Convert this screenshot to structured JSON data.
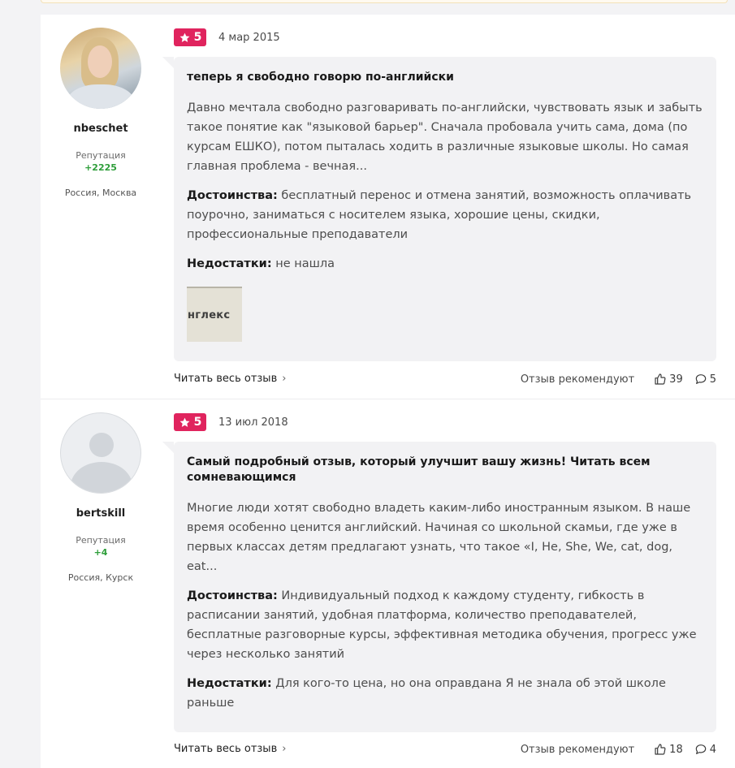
{
  "reviews": [
    {
      "username": "nbeschet",
      "reputation_label": "Репутация",
      "reputation_value": "+2225",
      "location": "Россия, Москва",
      "rating": "5",
      "date": "4 мар 2015",
      "title": "теперь я свободно говорю по-английски",
      "text": "Давно мечтала свободно разговаривать по-английски, чувствовать язык и забыть такое понятие как \"языковой барьер\". Сначала пробовала учить сама, дома (по курсам ЕШКО), потом пыталась ходить в различные языковые школы. Но самая главная проблема - вечная...",
      "pros_label": "Достоинства:",
      "pros": " бесплатный перенос и отмена занятий, возможность оплачивать поурочно, заниматься с носителем языка, хорошие цены, скидки, профессиональные преподаватели",
      "cons_label": "Недостатки:",
      "cons": " не нашла",
      "image_text": "нглекс",
      "read_more": "Читать весь отзыв",
      "recommend_label": "Отзыв рекомендуют",
      "likes": "39",
      "comments": "5"
    },
    {
      "username": "bertskill",
      "reputation_label": "Репутация",
      "reputation_value": "+4",
      "location": "Россия, Курск",
      "rating": "5",
      "date": "13 июл 2018",
      "title": "Самый подробный отзыв, который улучшит вашу жизнь! Читать всем сомневающимся",
      "text": "Многие люди хотят свободно владеть каким-либо иностранным языком. В наше время особенно ценится английский. Начиная со школьной скамьи, где уже в первых классах детям предлагают узнать, что такое «I, He, She, We, cat, dog, eat...",
      "pros_label": "Достоинства:",
      "pros": " Индивидуальный подход к каждому студенту, гибкость в расписании занятий, удобная платформа, количество преподавателей, бесплатные разговорные курсы, эффективная методика обучения, прогресс уже через несколько занятий",
      "cons_label": "Недостатки:",
      "cons": " Для кого-то цена, но она оправдана Я не знала об этой школе раньше",
      "read_more": "Читать весь отзыв",
      "recommend_label": "Отзыв рекомендуют",
      "likes": "18",
      "comments": "4"
    }
  ],
  "colors": {
    "rating_badge": "#e0245e",
    "reputation": "#2e9e3a",
    "bubble": "#f2f2f4"
  },
  "icons": {
    "rating": "star-icon",
    "likes": "thumbs-up-icon",
    "comments": "comment-icon",
    "read_more": "chevron-right-icon"
  }
}
